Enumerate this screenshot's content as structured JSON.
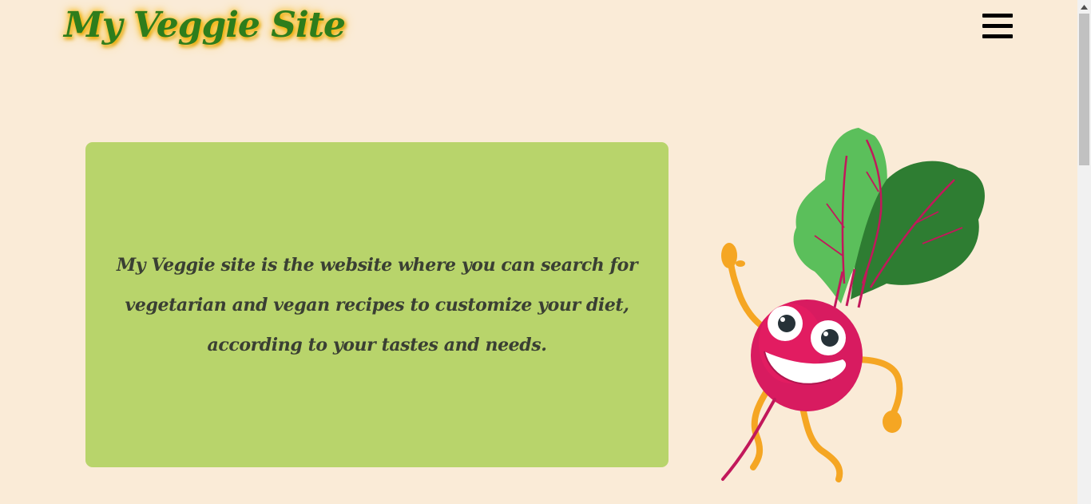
{
  "header": {
    "site_title": "My Veggie Site",
    "menu_icon": "hamburger-menu-icon"
  },
  "intro": {
    "text": "My Veggie site is the website where you can search for vegetarian and vegan recipes to customize your diet, according to your tastes and needs."
  },
  "illustration": {
    "subject": "dancing-beetroot-mascot"
  },
  "colors": {
    "background": "#faebd7",
    "title_green": "#2e7d1c",
    "title_glow": "#f6b500",
    "card_green": "#b8d46b",
    "text_dark": "#3a3f33"
  }
}
